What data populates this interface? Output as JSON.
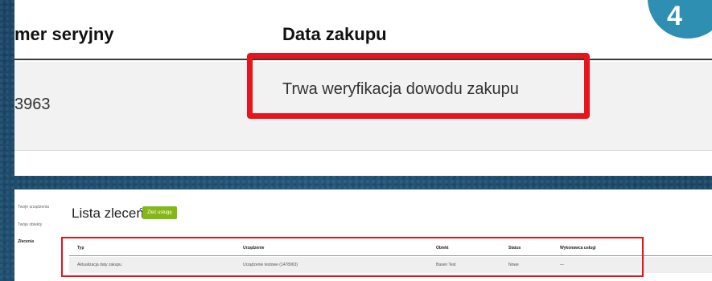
{
  "zoom": {
    "header": {
      "serial": "mer seryjny",
      "date": "Data zakupu"
    },
    "row": {
      "serial": "3963",
      "date": "Trwa weryfikacja dowodu zakupu"
    },
    "step_badge": "4"
  },
  "app": {
    "nav": [
      "Twoje urządzenia",
      "Twoje obiekty",
      "Zlecenia"
    ],
    "title": "Lista zleceń",
    "order_button": "Zleć usługę",
    "table": {
      "columns": [
        "Typ",
        "Urządzenie",
        "Obiekt",
        "Status",
        "Wykonawca usługi"
      ],
      "rows": [
        [
          "Aktualizacja daty zakupu",
          "Urządzenie testowe (1478963)",
          "Basen Test",
          "Nowe",
          "—"
        ]
      ]
    }
  },
  "colors": {
    "highlight": "#e8141b",
    "button": "#84b817",
    "badge": "#2f8fb3",
    "background": "#1d4a68"
  }
}
